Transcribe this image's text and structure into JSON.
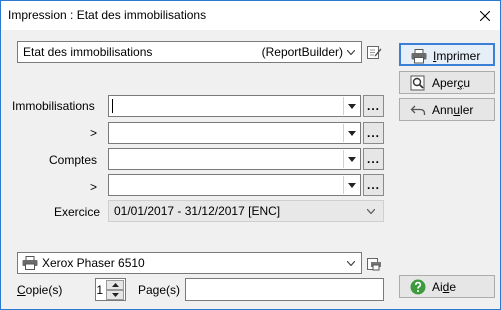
{
  "window": {
    "title": "Impression : Etat des immobilisations"
  },
  "report": {
    "name": "Etat des immobilisations",
    "engine": "(ReportBuilder)"
  },
  "filters": {
    "immobilisations_label": "Immobilisations",
    "immobilisations_to_label": ">",
    "comptes_label": "Comptes",
    "comptes_to_label": ">",
    "exercice_label": "Exercice",
    "exercice_value": "01/01/2017 - 31/12/2017 [ENC]"
  },
  "buttons": {
    "print": {
      "pre": "",
      "ul": "I",
      "post": "mprimer"
    },
    "preview": {
      "pre": "Aper",
      "ul": "ç",
      "post": "u"
    },
    "cancel": {
      "pre": "Ann",
      "ul": "u",
      "post": "ler"
    },
    "help": {
      "pre": "Ai",
      "ul": "d",
      "post": "e"
    }
  },
  "printer": {
    "name": "Xerox Phaser 6510"
  },
  "copies": {
    "label_ul": "C",
    "label_rest": "opie(s)",
    "value": "1"
  },
  "pages": {
    "label": "Page(s)",
    "value": ""
  },
  "ellipsis": "...",
  "icons": {
    "close": "close-icon",
    "report_edit": "edit-report-icon",
    "print": "printer-icon",
    "preview": "magnifier-icon",
    "cancel": "undo-arrow-icon",
    "help": "help-icon",
    "printer_props": "printer-properties-icon"
  }
}
